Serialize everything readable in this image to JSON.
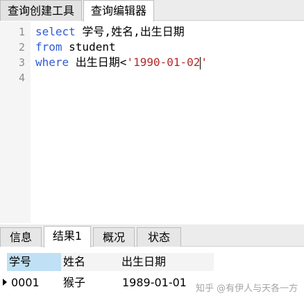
{
  "top_tabs": {
    "builder": "查询创建工具",
    "editor": "查询编辑器"
  },
  "editor": {
    "line_numbers": [
      "1",
      "2",
      "3",
      "4"
    ],
    "line1": {
      "kw": "select",
      "rest": " 学号,姓名,出生日期"
    },
    "line2": {
      "kw": "from",
      "rest": " student"
    },
    "line3": {
      "kw": "where",
      "rest": " 出生日期<",
      "str": "'1990-01-02",
      "str_end": "'"
    }
  },
  "bottom_tabs": {
    "info": "信息",
    "result": "结果1",
    "overview": "概况",
    "status": "状态"
  },
  "result": {
    "columns": [
      "学号",
      "姓名",
      "出生日期"
    ],
    "rows": [
      [
        "0001",
        "猴子",
        "1989-01-01"
      ]
    ]
  },
  "watermark": "知乎 @有伊人与天各一方",
  "colors": {
    "keyword": "#2f5bd6",
    "string": "#b22a2a",
    "selected_header": "#bfe0f5"
  }
}
